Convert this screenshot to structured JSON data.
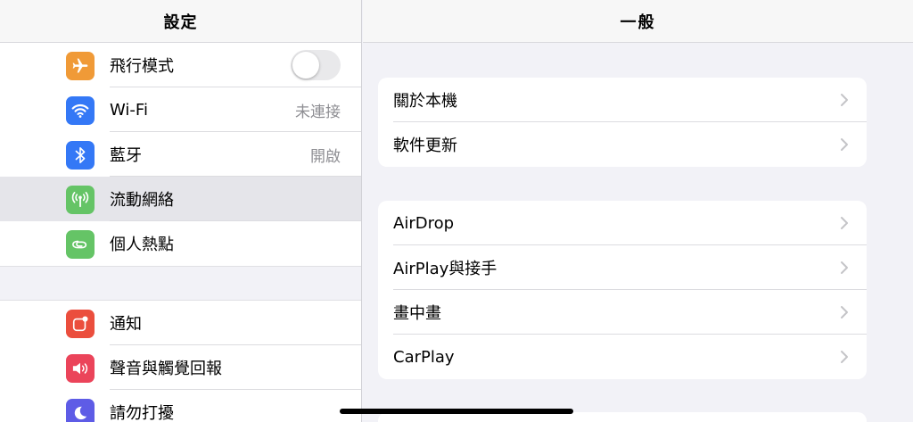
{
  "sidebar": {
    "title": "設定",
    "group1": [
      {
        "label": "飛行模式",
        "icon": "airplane-icon",
        "color": "#f09a37",
        "control": "toggle",
        "toggle_on": false
      },
      {
        "label": "Wi-Fi",
        "icon": "wifi-icon",
        "color": "#3478f6",
        "value": "未連接"
      },
      {
        "label": "藍牙",
        "icon": "bluetooth-icon",
        "color": "#3478f6",
        "value": "開啟"
      },
      {
        "label": "流動網絡",
        "icon": "antenna-icon",
        "color": "#65c466",
        "selected": true
      },
      {
        "label": "個人熱點",
        "icon": "hotspot-icon",
        "color": "#65c466"
      }
    ],
    "group2": [
      {
        "label": "通知",
        "icon": "notification-icon",
        "color": "#eb4e3d"
      },
      {
        "label": "聲音與觸覺回報",
        "icon": "speaker-icon",
        "color": "#eb445a"
      },
      {
        "label": "請勿打擾",
        "icon": "moon-icon",
        "color": "#5e5ce6"
      }
    ]
  },
  "main": {
    "title": "一般",
    "card1": [
      {
        "label": "關於本機"
      },
      {
        "label": "軟件更新"
      }
    ],
    "card2": [
      {
        "label": "AirDrop"
      },
      {
        "label": "AirPlay與接手"
      },
      {
        "label": "畫中畫"
      },
      {
        "label": "CarPlay"
      }
    ]
  }
}
